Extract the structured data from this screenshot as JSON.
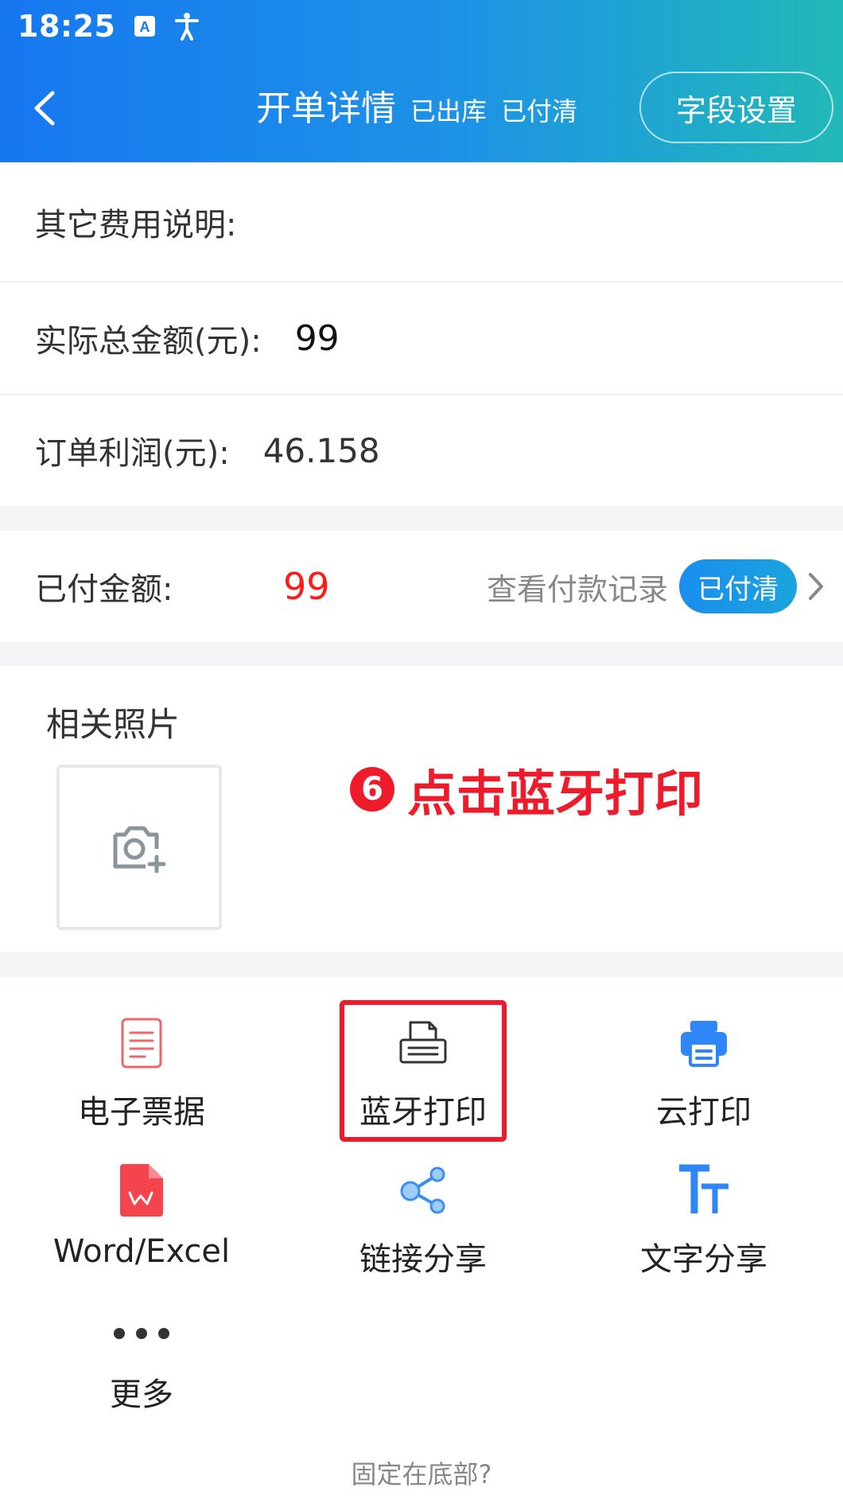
{
  "status_bar": {
    "time": "18:25",
    "icons": [
      "a-icon",
      "accessibility-icon"
    ]
  },
  "nav": {
    "back_icon": "chevron-left-icon",
    "title": "开单详情",
    "status_outbound": "已出库",
    "status_paid": "已付清",
    "settings_label": "字段设置"
  },
  "details": {
    "other_fees_label": "其它费用说明:",
    "other_fees_value": "",
    "actual_total_label": "实际总金额(元):",
    "actual_total_value": "99",
    "profit_label": "订单利润(元):",
    "profit_value": "46.158"
  },
  "payment": {
    "paid_label": "已付金额:",
    "paid_value": "99",
    "view_records": "查看付款记录",
    "badge": "已付清",
    "chevron_icon": "chevron-right-icon"
  },
  "photos": {
    "title": "相关照片",
    "add_icon": "add-photo-icon"
  },
  "annotation": {
    "number": "6",
    "text": "点击蓝牙打印"
  },
  "actions": {
    "items": [
      {
        "label": "电子票据",
        "icon": "document-icon"
      },
      {
        "label": "蓝牙打印",
        "icon": "receipt-printer-icon"
      },
      {
        "label": "云打印",
        "icon": "printer-icon"
      },
      {
        "label": "Word/Excel",
        "icon": "wps-file-icon"
      },
      {
        "label": "链接分享",
        "icon": "share-icon"
      },
      {
        "label": "文字分享",
        "icon": "text-size-icon"
      },
      {
        "label": "更多",
        "icon": "more-dots-icon"
      }
    ],
    "pin_bottom": "固定在底部?"
  },
  "colors": {
    "header_start": "#1677f0",
    "header_end": "#22b9b8",
    "accent_red": "#ee1c2a",
    "paid_red": "#ff1a1a",
    "badge_blue": "#1a8ef0"
  }
}
